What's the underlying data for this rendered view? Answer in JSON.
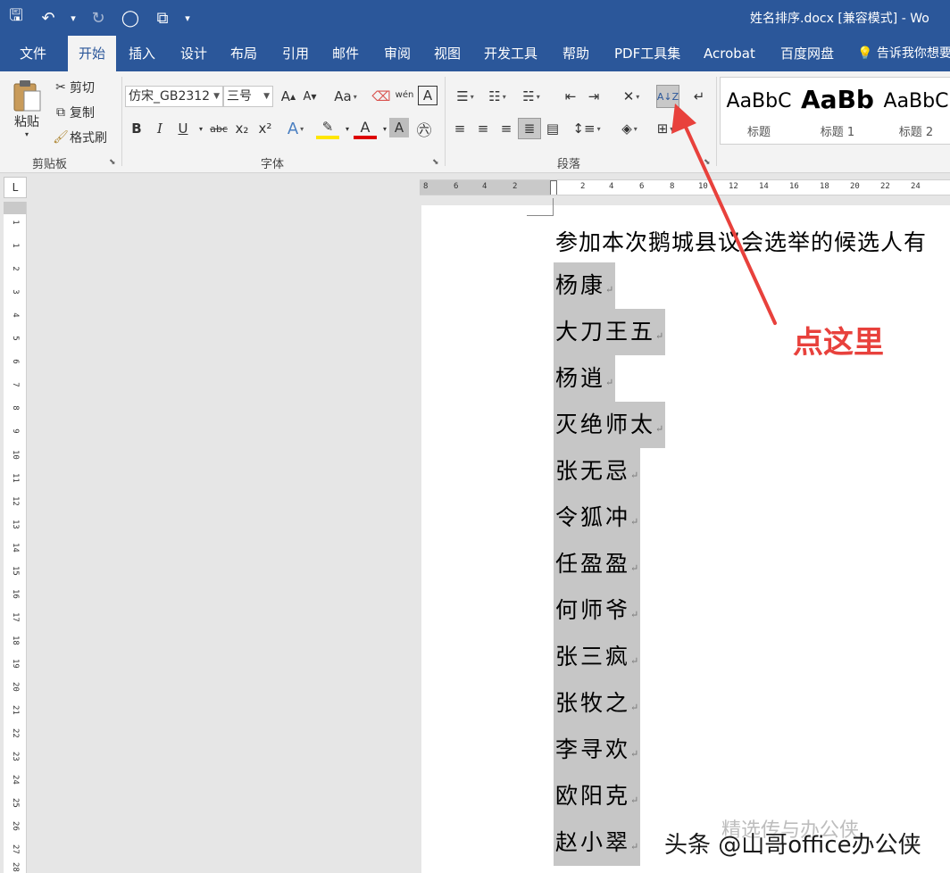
{
  "window": {
    "title": "姓名排序.docx [兼容模式]  -  Wo"
  },
  "qat": {
    "save": "🖫",
    "undo": "↶",
    "redo": "↻",
    "circle": "◯",
    "touch": "⧉",
    "customize": "▾"
  },
  "tabs": [
    "文件",
    "开始",
    "插入",
    "设计",
    "布局",
    "引用",
    "邮件",
    "审阅",
    "视图",
    "开发工具",
    "帮助",
    "PDF工具集",
    "Acrobat",
    "百度网盘"
  ],
  "tell_me": "告诉我你想要",
  "clipboard": {
    "paste": "粘贴",
    "cut": "剪切",
    "copy": "复制",
    "format_painter": "格式刷",
    "group_label": "剪贴板"
  },
  "font": {
    "name": "仿宋_GB2312",
    "size": "三号",
    "group_label": "字体",
    "bold": "B",
    "italic": "I",
    "underline": "U",
    "strike": "abc",
    "subscript": "x₂",
    "superscript": "x²",
    "grow": "A",
    "shrink": "A",
    "case": "Aa",
    "phonetic": "wén",
    "border_char": "A"
  },
  "paragraph": {
    "group_label": "段落",
    "sort": "A↓Z"
  },
  "styles": [
    {
      "sample": "AaBbC",
      "name": "标题"
    },
    {
      "sample": "AaBb",
      "name": "标题 1"
    },
    {
      "sample": "AaBbC",
      "name": "标题 2"
    }
  ],
  "ruler": {
    "corner_label": "L",
    "h_ticks": [
      "8",
      "6",
      "4",
      "2",
      "2",
      "4",
      "6",
      "8",
      "10",
      "12",
      "14",
      "16",
      "18",
      "20",
      "22",
      "24"
    ],
    "v_ticks": [
      "1",
      "1",
      "2",
      "3",
      "4",
      "5",
      "6",
      "7",
      "8",
      "9",
      "10",
      "11",
      "12",
      "13",
      "14",
      "15",
      "16",
      "17",
      "18",
      "19",
      "20",
      "21",
      "22",
      "23",
      "24",
      "25",
      "26",
      "27",
      "28"
    ]
  },
  "document": {
    "title_line": "参加本次鹅城县议会选举的候选人有",
    "names": [
      "杨康",
      "大刀王五",
      "杨逍",
      "灭绝师太",
      "张无忌",
      "令狐冲",
      "任盈盈",
      "何师爷",
      "张三疯",
      "张牧之",
      "李寻欢",
      "欧阳克",
      "赵小翠"
    ],
    "paragraph_mark": "↵"
  },
  "annotation": {
    "text": "点这里",
    "color": "#e8413c"
  },
  "watermark": {
    "faint": "精选传与办公侠",
    "main": "头条 @山哥office办公侠"
  },
  "colors": {
    "accent": "#2b579a",
    "selection": "#c6c6c6"
  }
}
